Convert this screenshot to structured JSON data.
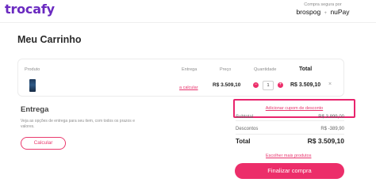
{
  "header": {
    "logo": "trocafy",
    "secure_label": "Compra segura por",
    "brand_one": "brospog",
    "brand_plus": "+",
    "brand_two": "nuPay"
  },
  "page": {
    "title": "Meu Carrinho"
  },
  "cart": {
    "columns": {
      "product": "Produto",
      "delivery": "Entrega",
      "price": "Preço",
      "quantity": "Quantidade",
      "total": "Total"
    },
    "item": {
      "delivery_link": "a calcular",
      "price": "R$ 3.509,10",
      "minus": "−",
      "quantity": "1",
      "plus": "+",
      "total": "R$ 3.509,10",
      "remove": "×"
    }
  },
  "delivery": {
    "title": "Entrega",
    "description": "Veja as opções de entrega para seu item, com todos os prazos e valores.",
    "calculate_button": "Calcular"
  },
  "summary": {
    "coupon_link": "Adicionar cupom de desconto",
    "subtotal_label": "Subtotal",
    "subtotal_value": "R$ 3.899,00",
    "discounts_label": "Descontos",
    "discounts_value": "R$ -389,90",
    "total_label": "Total",
    "total_value": "R$ 3.509,10",
    "more_products_link": "Escolher mais produtos",
    "checkout_button": "Finalizar compra"
  },
  "colors": {
    "brand_purple": "#6a2ac0",
    "accent_pink": "#ec2e6a",
    "highlight_border": "#e8246d"
  }
}
